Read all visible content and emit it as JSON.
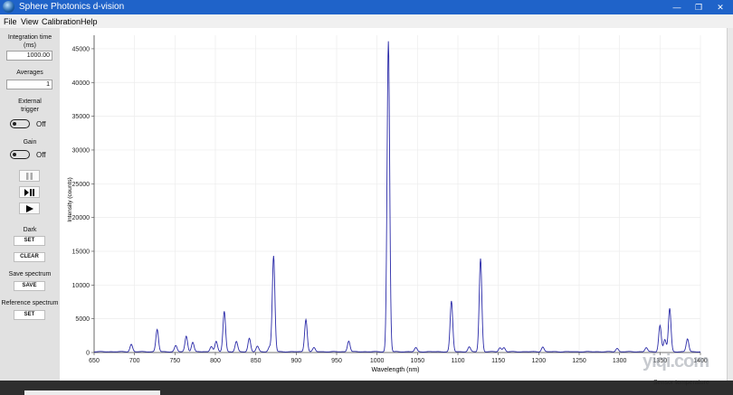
{
  "window": {
    "title": "Sphere Photonics d-vision",
    "controls": [
      "—",
      "❐",
      "✕"
    ]
  },
  "menu": [
    "File",
    "View",
    "Calibration",
    "Help"
  ],
  "sidebar": {
    "integration_label": "Integration time (ms)",
    "integration_value": "1000.00",
    "averages_label": "Averages",
    "averages_value": "1",
    "external_trigger_label": "External trigger",
    "external_trigger_state": "Off",
    "gain_label": "Gain",
    "gain_state": "Off",
    "dark_label": "Dark",
    "dark_set": "SET",
    "dark_clear": "CLEAR",
    "save_label": "Save spectrum",
    "save_button": "SAVE",
    "reference_label": "Reference spectrum",
    "reference_set": "SET"
  },
  "status": {
    "sensor": "Sensor temperature"
  },
  "watermark": "yiqi.com",
  "chart_data": {
    "type": "line",
    "xlabel": "Wavelength (nm)",
    "ylabel": "Intensity (counts)",
    "xlim": [
      650,
      1400
    ],
    "ylim": [
      0,
      47000
    ],
    "xticks": [
      650,
      700,
      750,
      800,
      850,
      900,
      950,
      1000,
      1050,
      1100,
      1150,
      1200,
      1250,
      1300,
      1350,
      1400
    ],
    "yticks": [
      0,
      5000,
      10000,
      15000,
      20000,
      25000,
      30000,
      35000,
      40000,
      45000
    ],
    "grid": true,
    "line_color": "#2a2aa8",
    "peaks": [
      {
        "x": 696,
        "y": 1100
      },
      {
        "x": 728,
        "y": 3300
      },
      {
        "x": 751,
        "y": 900
      },
      {
        "x": 764,
        "y": 2300
      },
      {
        "x": 772,
        "y": 1400
      },
      {
        "x": 795,
        "y": 800
      },
      {
        "x": 801,
        "y": 1500
      },
      {
        "x": 811,
        "y": 6000
      },
      {
        "x": 826,
        "y": 1500
      },
      {
        "x": 842,
        "y": 2000
      },
      {
        "x": 852,
        "y": 800
      },
      {
        "x": 867,
        "y": 700
      },
      {
        "x": 872,
        "y": 14200
      },
      {
        "x": 912,
        "y": 4800
      },
      {
        "x": 922,
        "y": 600
      },
      {
        "x": 965,
        "y": 1600
      },
      {
        "x": 1014,
        "y": 46000
      },
      {
        "x": 1048,
        "y": 600
      },
      {
        "x": 1092,
        "y": 7500
      },
      {
        "x": 1114,
        "y": 700
      },
      {
        "x": 1128,
        "y": 13800
      },
      {
        "x": 1152,
        "y": 600
      },
      {
        "x": 1157,
        "y": 600
      },
      {
        "x": 1205,
        "y": 700
      },
      {
        "x": 1297,
        "y": 500
      },
      {
        "x": 1333,
        "y": 600
      },
      {
        "x": 1350,
        "y": 3900
      },
      {
        "x": 1356,
        "y": 1800
      },
      {
        "x": 1362,
        "y": 6400
      },
      {
        "x": 1384,
        "y": 1900
      }
    ]
  }
}
